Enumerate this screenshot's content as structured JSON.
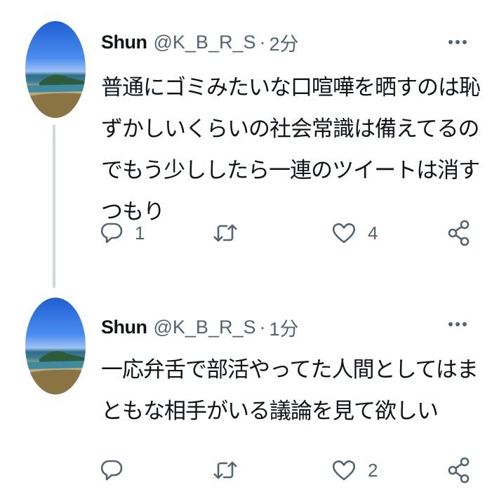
{
  "thread": [
    {
      "author_name": "Shun",
      "handle": "@K_B_R_S",
      "separator": "·",
      "time": "2分",
      "text": "普通にゴミみたいな口喧嘩を晒すのは恥ずかしいくらいの社会常識は備えてるのでもう少ししたら一連のツイートは消すつもり",
      "reply_count": "1",
      "retweet_count": "",
      "like_count": "4"
    },
    {
      "author_name": "Shun",
      "handle": "@K_B_R_S",
      "separator": "·",
      "time": "1分",
      "text": "一応弁舌で部活やってた人間としてはまともな相手がいる議論を見て欲しい",
      "reply_count": "",
      "retweet_count": "",
      "like_count": "2"
    }
  ],
  "icons": {
    "reply": "reply-icon",
    "retweet": "retweet-icon",
    "like": "heart-icon",
    "share": "share-icon",
    "more": "more-options-icon"
  },
  "colors": {
    "text_primary": "#0f1419",
    "text_secondary": "#536471",
    "thread_line": "#cfd9de"
  }
}
